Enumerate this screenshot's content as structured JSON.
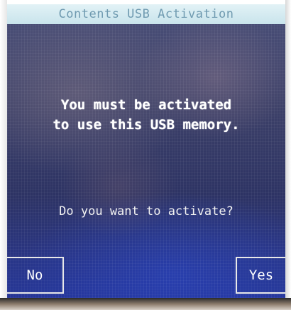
{
  "dialog": {
    "title": "Contents USB Activation",
    "message_line1": "You must be activated",
    "message_line2": "to use this USB memory.",
    "question": "Do you want to activate?"
  },
  "buttons": {
    "no_label": "No",
    "yes_label": "Yes"
  },
  "colors": {
    "title_bar": "#c9e4ec",
    "title_text": "#6f9ab0",
    "screen_background": "#2d3364",
    "text": "#ffffff"
  }
}
